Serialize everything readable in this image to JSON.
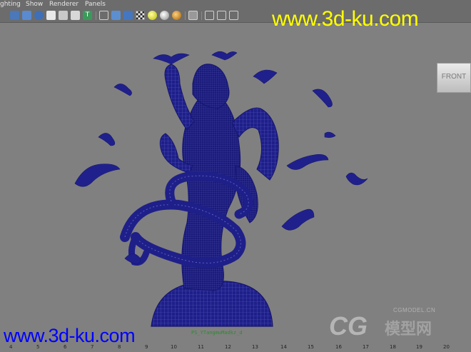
{
  "menu": {
    "lighting": "ghting",
    "show": "Show",
    "renderer": "Renderer",
    "panels": "Panels"
  },
  "viewport": {
    "view_cube_label": "FRONT",
    "status_text": "PS_YTangmuMadkz_d"
  },
  "watermarks": {
    "top": "www.3d-ku.com",
    "bottom": "www.3d-ku.com",
    "logo_small": "CGMODEL.CN",
    "logo_big": "CG",
    "logo_cn": "模型网"
  },
  "ruler": {
    "ticks": [
      "4",
      "5",
      "6",
      "7",
      "8",
      "9",
      "10",
      "11",
      "12",
      "13",
      "14",
      "15",
      "16",
      "17",
      "18",
      "19",
      "20"
    ]
  },
  "toolbar_icons": [
    "wireframe-icon",
    "smooth-shade-icon",
    "textured-icon",
    "lights-icon",
    "shadows-icon",
    "xray-icon",
    "text-icon",
    "cube-wire-icon",
    "cube-shaded-icon",
    "checker-icon",
    "light-sphere-icon",
    "grey-sphere-icon",
    "orange-sphere-icon",
    "resolution-gate-icon",
    "isolate-icon",
    "camera-icon"
  ],
  "colors": {
    "wireframe": "#1a1a8c",
    "background": "#808080",
    "watermark_top": "#ffff00",
    "watermark_bottom": "#0000ff"
  }
}
